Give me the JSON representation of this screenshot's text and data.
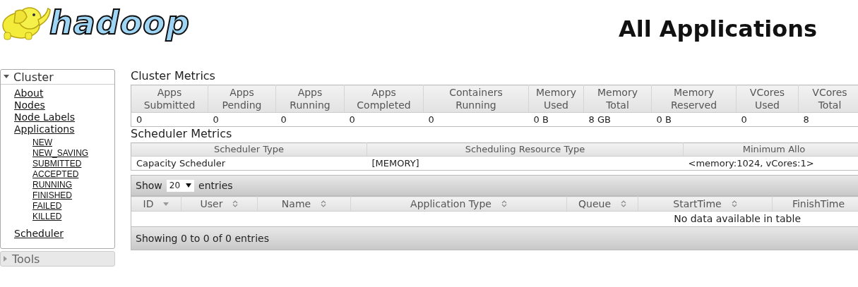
{
  "logo": {
    "text": "hadoop"
  },
  "page_title": "All Applications",
  "sidebar": {
    "sections": [
      {
        "title": "Cluster",
        "expanded": true,
        "items": [
          {
            "label": "About"
          },
          {
            "label": "Nodes"
          },
          {
            "label": "Node Labels"
          },
          {
            "label": "Applications",
            "children": [
              {
                "label": "NEW"
              },
              {
                "label": "NEW_SAVING"
              },
              {
                "label": "SUBMITTED"
              },
              {
                "label": "ACCEPTED"
              },
              {
                "label": "RUNNING"
              },
              {
                "label": "FINISHED"
              },
              {
                "label": "FAILED"
              },
              {
                "label": "KILLED"
              }
            ]
          },
          {
            "label": "Scheduler"
          }
        ]
      },
      {
        "title": "Tools",
        "expanded": false
      }
    ]
  },
  "cluster_metrics": {
    "title": "Cluster Metrics",
    "columns": [
      "Apps Submitted",
      "Apps Pending",
      "Apps Running",
      "Apps Completed",
      "Containers Running",
      "Memory Used",
      "Memory Total",
      "Memory Reserved",
      "VCores Used",
      "VCores Total"
    ],
    "row": [
      "0",
      "0",
      "0",
      "0",
      "0",
      "0 B",
      "8 GB",
      "0 B",
      "0",
      "8"
    ]
  },
  "scheduler_metrics": {
    "title": "Scheduler Metrics",
    "columns": [
      "Scheduler Type",
      "Scheduling Resource Type",
      "Minimum Allo"
    ],
    "row": [
      "Capacity Scheduler",
      "[MEMORY]",
      "<memory:1024, vCores:1>"
    ]
  },
  "apps_table": {
    "show_label": "Show",
    "page_size": "20",
    "entries_label": "entries",
    "columns": [
      {
        "label": "ID",
        "sorted": true
      },
      {
        "label": "User",
        "sorted": false
      },
      {
        "label": "Name",
        "sorted": false
      },
      {
        "label": "Application Type",
        "sorted": false
      },
      {
        "label": "Queue",
        "sorted": false
      },
      {
        "label": "StartTime",
        "sorted": false
      },
      {
        "label": "FinishTime",
        "sorted": false
      }
    ],
    "empty_message": "No data available in table",
    "info": "Showing 0 to 0 of 0 entries"
  }
}
